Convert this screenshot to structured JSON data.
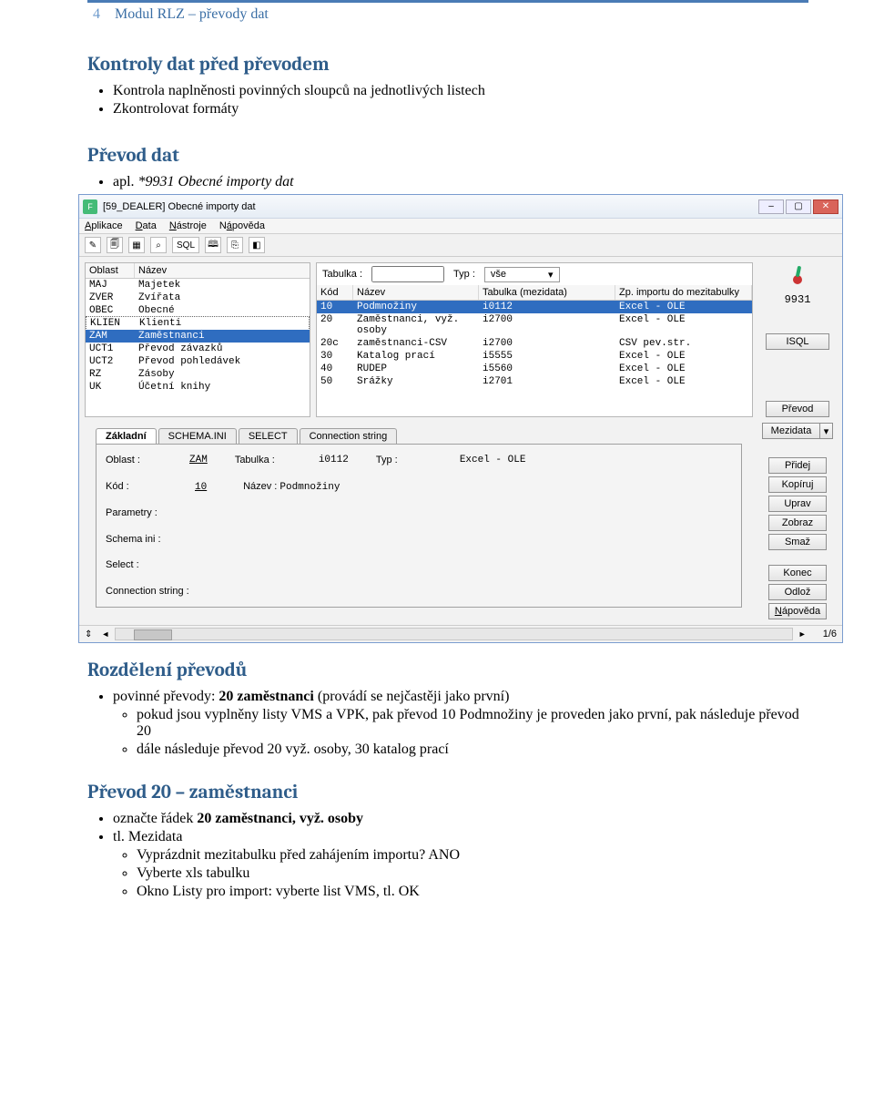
{
  "header": {
    "page_num": "4",
    "title": "Modul RLZ – převody dat"
  },
  "sections": {
    "kontroly": {
      "title": "Kontroly dat před převodem",
      "items": [
        "Kontrola naplněnosti povinných sloupců na jednotlivých listech",
        "Zkontrolovat formáty"
      ]
    },
    "prevod_dat": {
      "title": "Převod dat",
      "item": "apl. *9931 Obecné importy dat"
    },
    "rozdeleni": {
      "title": "Rozdělení převodů",
      "main": "povinné převody: 20 zaměstnanci (provádí se nejčastěji jako první)",
      "sub": [
        "pokud jsou vyplněny listy VMS a VPK, pak převod 10 Podmnožiny je proveden jako první, pak následuje převod 20",
        "dále následuje převod 20 vyž. osoby, 30 katalog prací"
      ]
    },
    "prevod20": {
      "title": "Převod 20 – zaměstnanci",
      "items": [
        "označte řádek 20 zaměstnanci, vyž. osoby",
        "tl. Mezidata"
      ],
      "sub": [
        "Vyprázdnit mezitabulku před zahájením importu? ANO",
        "Vyberte xls tabulku",
        "Okno Listy pro import: vyberte list VMS, tl. OK"
      ]
    }
  },
  "app": {
    "title": "[59_DEALER] Obecné importy dat",
    "menus": [
      "Aplikace",
      "Data",
      "Nástroje",
      "Nápověda"
    ],
    "left_hdr": [
      "Oblast",
      "Název"
    ],
    "left_rows": [
      {
        "c1": "MAJ",
        "c2": "Majetek",
        "sel": false
      },
      {
        "c1": "ZVER",
        "c2": "Zvířata",
        "sel": false
      },
      {
        "c1": "OBEC",
        "c2": "Obecné",
        "sel": false
      },
      {
        "c1": "KLIEN",
        "c2": "Klienti",
        "sel": false,
        "dot": true
      },
      {
        "c1": "ZAM",
        "c2": "Zaměstnanci",
        "sel": true
      },
      {
        "c1": "UCT1",
        "c2": "Převod závazků",
        "sel": false
      },
      {
        "c1": "UCT2",
        "c2": "Převod pohledávek",
        "sel": false
      },
      {
        "c1": "RZ",
        "c2": "Zásoby",
        "sel": false
      },
      {
        "c1": "UK",
        "c2": "Účetní knihy",
        "sel": false
      }
    ],
    "mid_top": {
      "tab_lbl": "Tabulka :",
      "typ_lbl": "Typ :",
      "typ_val": "vše"
    },
    "mid_hdr": [
      "Kód",
      "Název",
      "Tabulka (mezidata)",
      "Zp. importu do mezitabulky"
    ],
    "mid_rows": [
      {
        "k": "10",
        "n": "Podmnožiny",
        "t": "i0112",
        "z": "Excel - OLE",
        "sel": true
      },
      {
        "k": "20",
        "n": "Zaměstnanci, vyž. osoby",
        "t": "i2700",
        "z": "Excel - OLE"
      },
      {
        "k": "20c",
        "n": "zaměstnanci-CSV",
        "t": "i2700",
        "z": "CSV pev.str."
      },
      {
        "k": "30",
        "n": "Katalog prací",
        "t": "i5555",
        "z": "Excel - OLE"
      },
      {
        "k": "40",
        "n": "RUDEP",
        "t": "i5560",
        "z": "Excel - OLE"
      },
      {
        "k": "50",
        "n": "Srážky",
        "t": "i2701",
        "z": "Excel - OLE"
      }
    ],
    "right_num": "9931",
    "btn_isql": "ISQL",
    "btn_prevod": "Převod",
    "tabs": [
      "Základní",
      "SCHEMA.INI",
      "SELECT",
      "Connection string"
    ],
    "detail": {
      "oblast_lbl": "Oblast :",
      "oblast_val": "ZAM",
      "tabulka_lbl": "Tabulka :",
      "tabulka_val": "i0112",
      "typ_lbl": "Typ :",
      "typ_val": "Excel - OLE",
      "kod_lbl": "Kód :",
      "kod_val": "10",
      "nazev_lbl": "Název :",
      "nazev_val": "Podmnožiny",
      "par_lbl": "Parametry :",
      "schema_lbl": "Schema ini :",
      "select_lbl": "Select :",
      "conn_lbl": "Connection string :"
    },
    "sidebtns": [
      "Mezidata",
      "Přidej",
      "Kopíruj",
      "Uprav",
      "Zobraz",
      "Smaž",
      "Konec",
      "Odlož",
      "Nápověda"
    ],
    "status_right": "1/6"
  }
}
